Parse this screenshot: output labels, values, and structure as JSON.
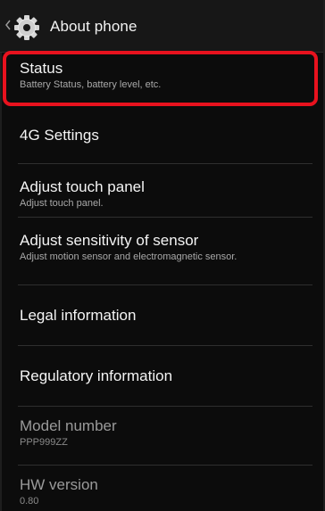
{
  "action_bar": {
    "title": "About phone",
    "icon": "settings-gear-icon",
    "up_icon": "chevron-left-icon"
  },
  "items": [
    {
      "title": "Status",
      "summary": "Battery Status, battery level, etc.",
      "enabled": true,
      "highlighted": true
    },
    {
      "title": "4G Settings",
      "summary": "",
      "enabled": true
    },
    {
      "title": "Adjust touch panel",
      "summary": "Adjust touch panel.",
      "enabled": true
    },
    {
      "title": "Adjust sensitivity of sensor",
      "summary": "Adjust motion sensor and electromagnetic sensor.",
      "enabled": true
    },
    {
      "title": "Legal information",
      "summary": "",
      "enabled": true
    },
    {
      "title": "Regulatory information",
      "summary": "",
      "enabled": true
    },
    {
      "title": "Model number",
      "summary": "PPP999ZZ",
      "enabled": false
    },
    {
      "title": "HW version",
      "summary": "0.80",
      "enabled": false
    }
  ],
  "colors": {
    "highlight_border": "#e8121e",
    "background": "#0c0c0c",
    "title_text": "#f4f4f4",
    "summary_text": "#a9a9a9"
  }
}
